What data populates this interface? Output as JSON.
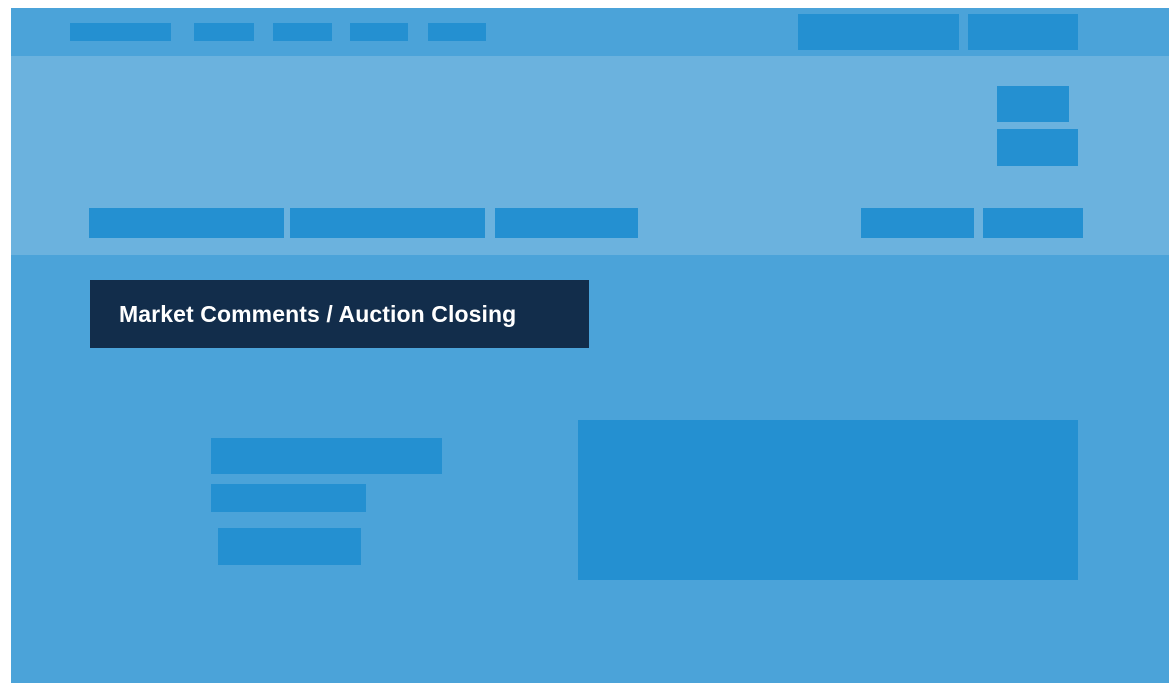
{
  "colors": {
    "page_bg": "#FFFFFF",
    "topbar_bg": "#4BA3D9",
    "hero_bg": "#6BB2DE",
    "content_bg": "#4BA3D9",
    "placeholder_block": "#2490D1",
    "label_bg": "#122D4B",
    "label_text": "#FFFFFF"
  },
  "content": {
    "section_label": "Market Comments / Auction Closing"
  }
}
